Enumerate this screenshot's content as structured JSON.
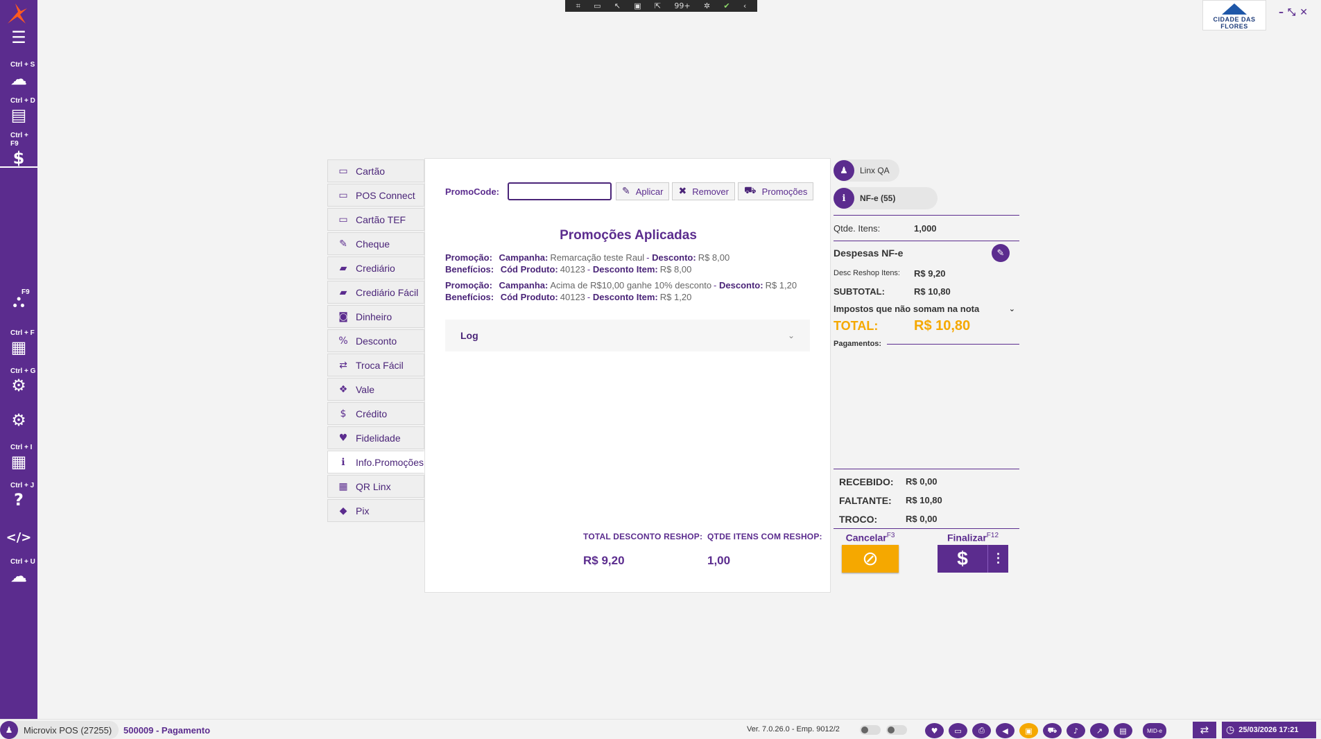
{
  "sidebar": {
    "logo": "linx-logo",
    "items": [
      {
        "icon": "menu-icon",
        "glyph": "☰",
        "shortcut": ""
      },
      {
        "icon": "cloud-icon",
        "glyph": "☁",
        "shortcut": "Ctrl + S"
      },
      {
        "icon": "document-icon",
        "glyph": "▤",
        "shortcut": "Ctrl + D"
      },
      {
        "icon": "dollar-icon",
        "glyph": "$",
        "shortcut": "Ctrl + F9"
      },
      {
        "icon": "shopping-bag-icon",
        "glyph": "⛬",
        "shortcut": "F9"
      },
      {
        "icon": "qr-code-icon",
        "glyph": "▦",
        "shortcut": "Ctrl + F"
      },
      {
        "icon": "gears-icon",
        "glyph": "⚙",
        "shortcut": "Ctrl + G"
      },
      {
        "icon": "settings-icon",
        "glyph": "⚙",
        "shortcut": ""
      },
      {
        "icon": "apps-grid-icon",
        "glyph": "▦",
        "shortcut": "Ctrl + I"
      },
      {
        "icon": "help-icon",
        "glyph": "?",
        "shortcut": "Ctrl + J"
      },
      {
        "icon": "code-icon",
        "glyph": "</>",
        "shortcut": ""
      },
      {
        "icon": "cloud-download-icon",
        "glyph": "☁",
        "shortcut": "Ctrl + U"
      }
    ]
  },
  "top_toolbar": {
    "badge": "99+"
  },
  "logo": {
    "text": "CIDADE DAS FLORES"
  },
  "payment_menu": {
    "items": [
      {
        "label": "Cartão",
        "icon": "card-icon",
        "glyph": "▭"
      },
      {
        "label": "POS Connect",
        "icon": "card-icon",
        "glyph": "▭"
      },
      {
        "label": "Cartão TEF",
        "icon": "card-icon",
        "glyph": "▭"
      },
      {
        "label": "Cheque",
        "icon": "edit-icon",
        "glyph": "✎"
      },
      {
        "label": "Crediário",
        "icon": "book-icon",
        "glyph": "▰"
      },
      {
        "label": "Crediário Fácil",
        "icon": "book-icon",
        "glyph": "▰"
      },
      {
        "label": "Dinheiro",
        "icon": "money-icon",
        "glyph": "◙"
      },
      {
        "label": "Desconto",
        "icon": "percent-icon",
        "glyph": "%"
      },
      {
        "label": "Troca Fácil",
        "icon": "exchange-icon",
        "glyph": "⇄"
      },
      {
        "label": "Vale",
        "icon": "gift-icon",
        "glyph": "❖"
      },
      {
        "label": "Crédito",
        "icon": "dollar-icon",
        "glyph": "$"
      },
      {
        "label": "Fidelidade",
        "icon": "heart-icon",
        "glyph": "♥"
      },
      {
        "label": "Info.Promoções",
        "icon": "info-icon",
        "glyph": "ℹ"
      },
      {
        "label": "QR Linx",
        "icon": "qr-code-icon",
        "glyph": "▦"
      },
      {
        "label": "Pix",
        "icon": "pix-icon",
        "glyph": "◆"
      }
    ],
    "active_index": 12
  },
  "promo": {
    "label": "PromoCode:",
    "input_value": "",
    "apply_label": "Aplicar",
    "remove_label": "Remover",
    "promotions_label": "Promoções"
  },
  "applied": {
    "title": "Promoções Aplicadas",
    "items": [
      {
        "promocao_label": "Promoção:",
        "campanha_label": "Campanha:",
        "campanha": "Remarcação teste Raul",
        "desconto_label": "Desconto:",
        "desconto": "R$ 8,00",
        "beneficios_label": "Benefícios:",
        "cod_label": "Cód Produto:",
        "cod": "40123",
        "desconto_item_label": "Desconto Item:",
        "desconto_item": "R$ 8,00"
      },
      {
        "promocao_label": "Promoção:",
        "campanha_label": "Campanha:",
        "campanha": "Acima de R$10,00 ganhe 10% desconto",
        "desconto_label": "Desconto:",
        "desconto": "R$ 1,20",
        "beneficios_label": "Benefícios:",
        "cod_label": "Cód Produto:",
        "cod": "40123",
        "desconto_item_label": "Desconto Item:",
        "desconto_item": "R$ 1,20"
      }
    ]
  },
  "log": {
    "label": "Log"
  },
  "totals": {
    "total_desconto_label": "TOTAL DESCONTO RESHOP:",
    "total_desconto_value": "R$ 9,20",
    "qtde_label": "QTDE ITENS COM RESHOP:",
    "qtde_value": "1,00"
  },
  "right_panel": {
    "user_pill": "Linx QA",
    "doc_pill": "NF-e (55)",
    "qtde_label": "Qtde. Itens:",
    "qtde_value": "1,000",
    "despesas_title": "Despesas NF-e",
    "desc_reshop_label": "Desc Reshop Itens:",
    "desc_reshop_value": "R$ 9,20",
    "subtotal_label": "SUBTOTAL:",
    "subtotal_value": "R$ 10,80",
    "impostos_label": "Impostos que não somam na nota",
    "total_label": "TOTAL:",
    "total_value": "R$ 10,80",
    "pagamentos_label": "Pagamentos:",
    "recebido_label": "RECEBIDO:",
    "recebido_value": "R$ 0,00",
    "faltante_label": "FALTANTE:",
    "faltante_value": "R$ 10,80",
    "troco_label": "TROCO:",
    "troco_value": "R$ 0,00",
    "cancelar_label": "Cancelar",
    "cancelar_key": "F3",
    "finalizar_label": "Finalizar",
    "finalizar_key": "F12"
  },
  "status_bar": {
    "app_name": "Microvix POS (27255)",
    "screen": "500009 - Pagamento",
    "version": "Ver. 7.0.26.0 - Emp. 9012/2",
    "cloud_badge": "MID-e",
    "datetime": "25/03/2026 17:21"
  },
  "colors": {
    "brand_purple": "#5b2c8e",
    "accent_orange": "#f5a800"
  }
}
